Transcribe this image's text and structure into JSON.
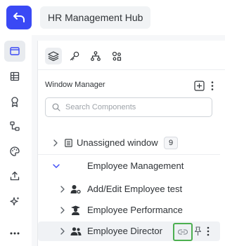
{
  "header": {
    "back_icon": "undo-arrow-icon",
    "app_title": "HR Management Hub",
    "accent_color": "#3a49f5"
  },
  "rail": {
    "items": [
      {
        "icon": "window-icon",
        "active": true
      },
      {
        "icon": "table-icon",
        "active": false
      },
      {
        "icon": "award-icon",
        "active": false
      },
      {
        "icon": "flow-icon",
        "active": false
      },
      {
        "icon": "palette-icon",
        "active": false
      },
      {
        "icon": "upload-icon",
        "active": false
      },
      {
        "icon": "sparkle-icon",
        "active": false
      },
      {
        "icon": "more-horizontal-icon",
        "active": false
      }
    ]
  },
  "panel": {
    "tabs": [
      {
        "icon": "layers-icon",
        "active": true
      },
      {
        "icon": "key-icon",
        "active": false
      },
      {
        "icon": "hierarchy-icon",
        "active": false
      },
      {
        "icon": "shapes-icon",
        "active": false
      }
    ],
    "title": "Window Manager",
    "search": {
      "placeholder": "Search Components",
      "value": ""
    },
    "tree": {
      "unassigned": {
        "label": "Unassigned window",
        "count": "9"
      },
      "group": {
        "label": "Employee Management",
        "expanded": true
      },
      "children": [
        {
          "label": "Add/Edit Employee test",
          "icon": "user-gear-icon"
        },
        {
          "label": "Employee Performance",
          "icon": "graduate-icon"
        },
        {
          "label": "Employee Director",
          "icon": "users-icon",
          "selected": true
        }
      ]
    }
  },
  "colors": {
    "highlight_border": "#4caf50"
  }
}
